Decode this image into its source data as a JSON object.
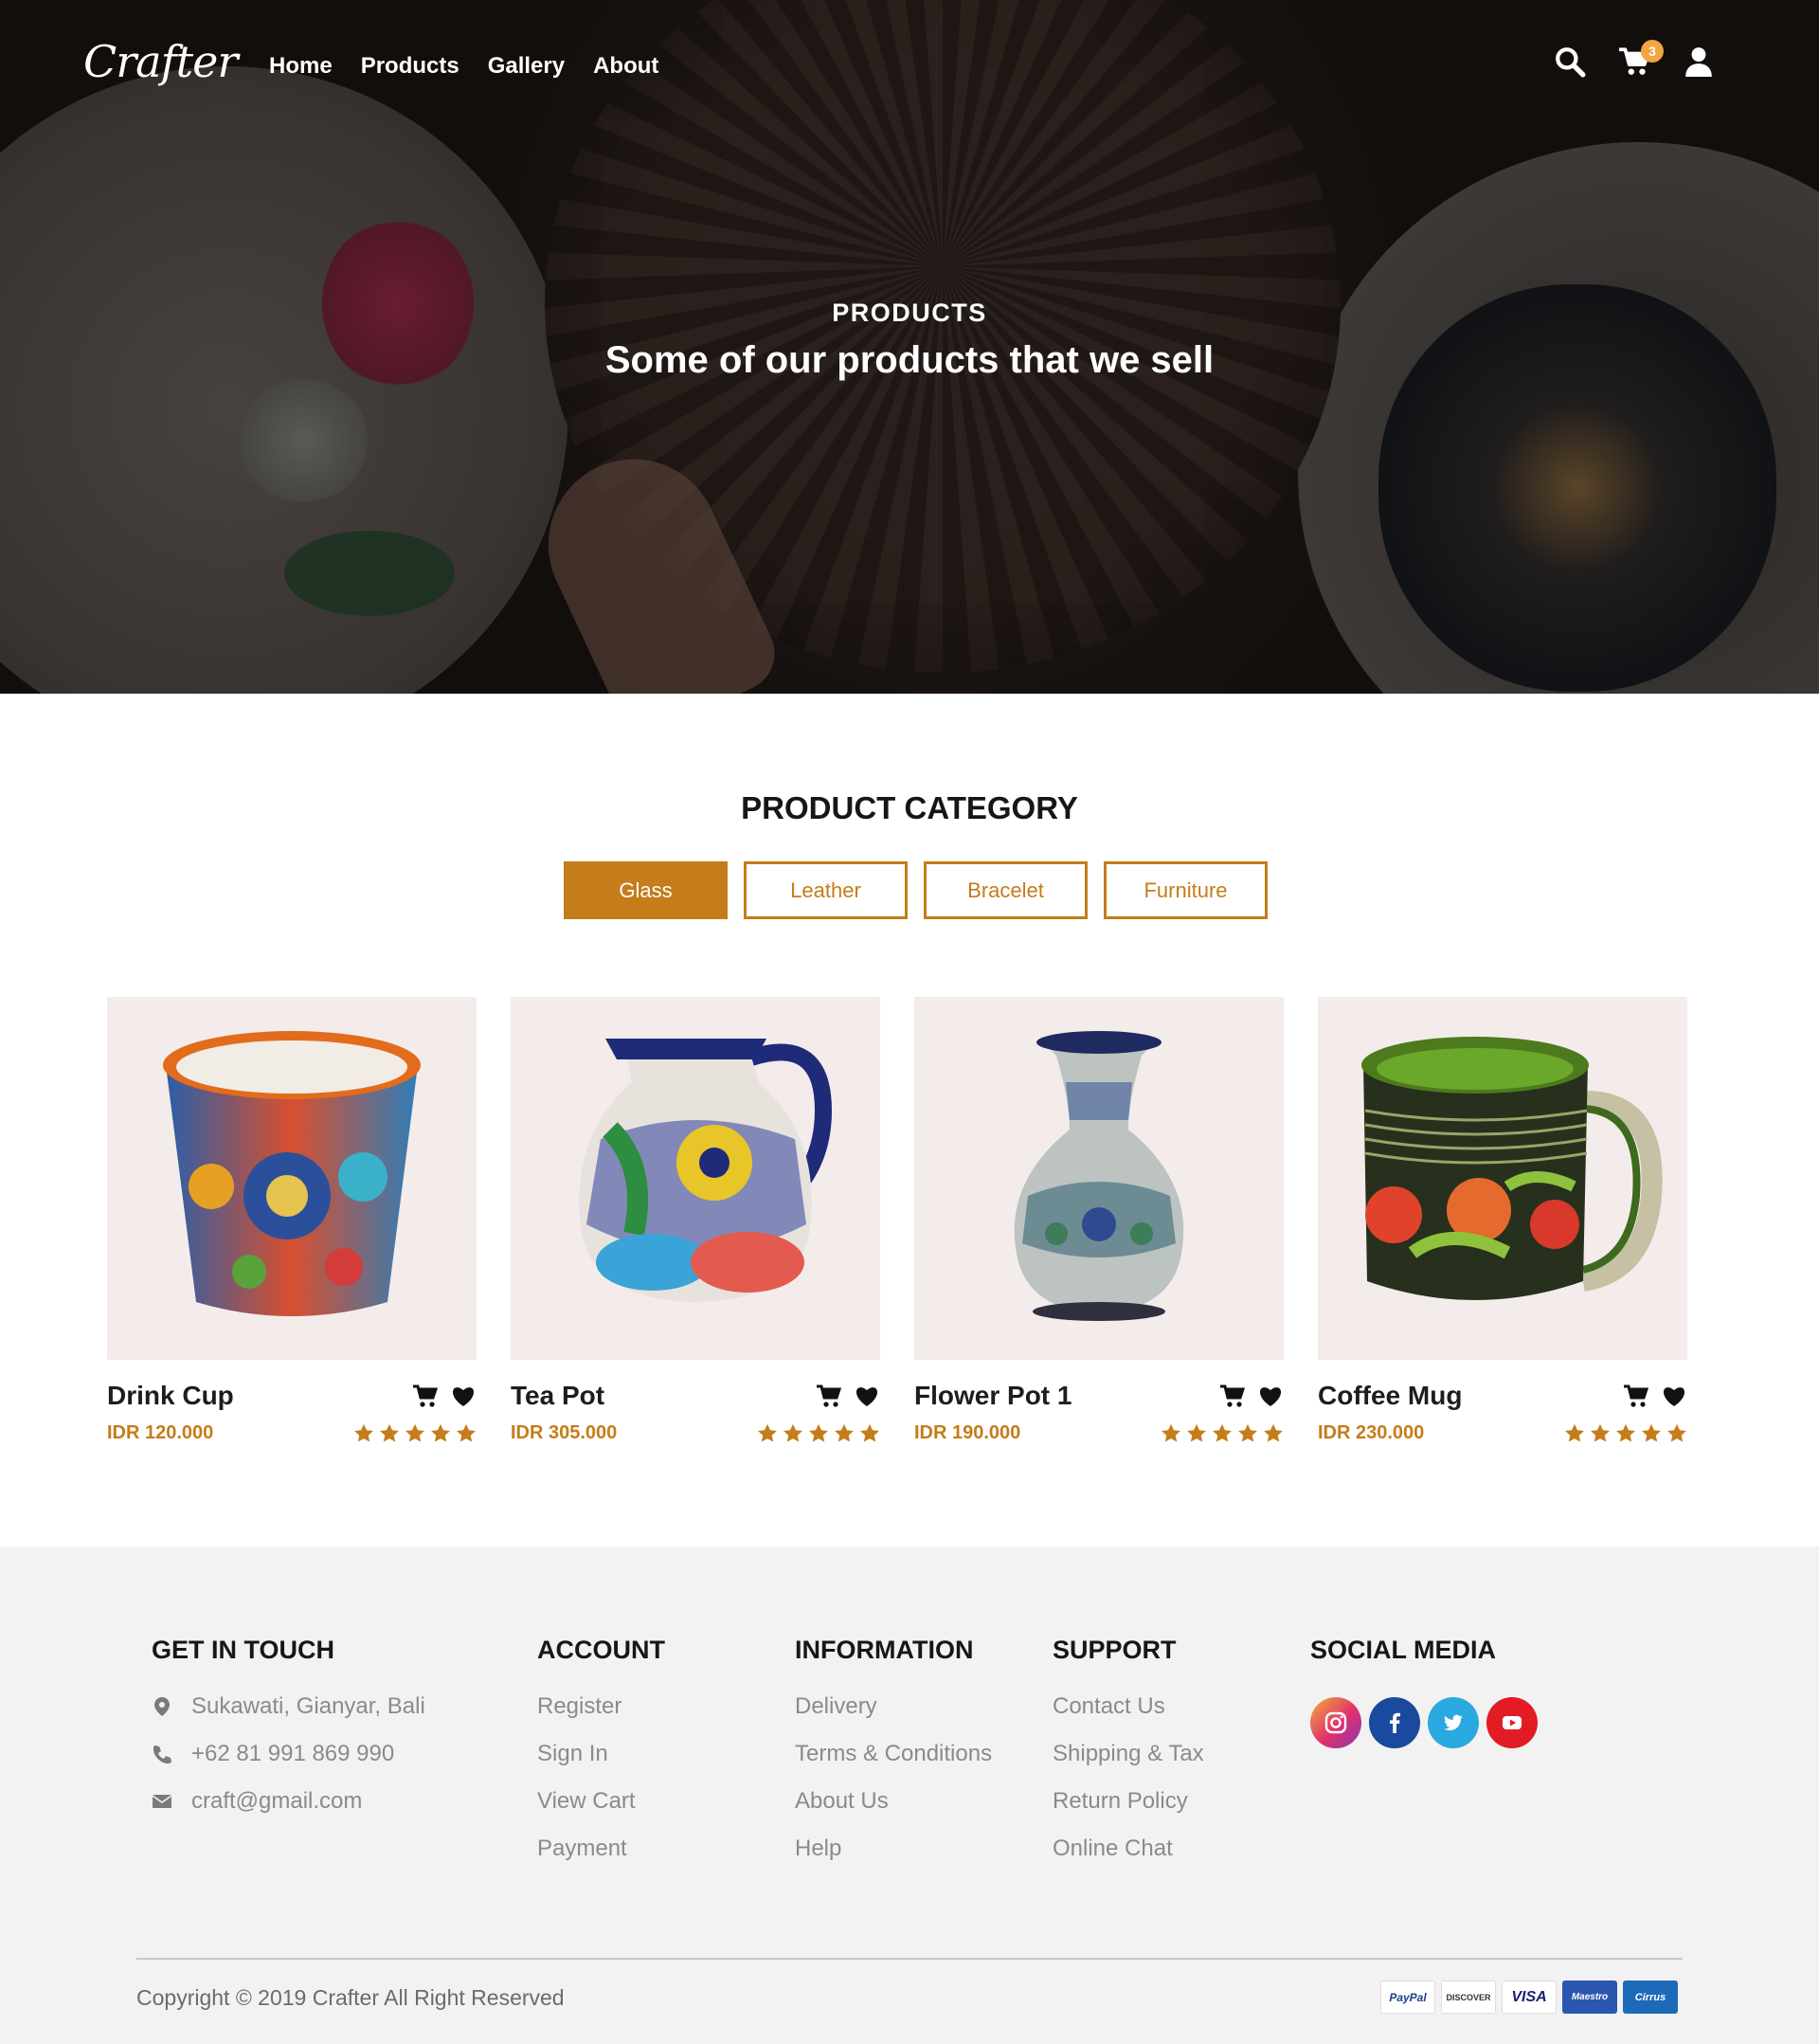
{
  "brand": {
    "logo": "Crafter",
    "accent": "#c57c1a",
    "badge_color": "#f2a540"
  },
  "nav": {
    "links": [
      "Home",
      "Products",
      "Gallery",
      "About"
    ],
    "cart_count": "3",
    "icons": [
      "search-icon",
      "cart-icon",
      "user-icon"
    ]
  },
  "hero": {
    "kicker": "PRODUCTS",
    "title": "Some of our products that we sell"
  },
  "category": {
    "title": "PRODUCT CATEGORY",
    "tabs": [
      "Glass",
      "Leather",
      "Bracelet",
      "Furniture"
    ],
    "active_tab": "Glass"
  },
  "products": [
    {
      "name": "Drink Cup",
      "price": "IDR 120.000",
      "rating": 5
    },
    {
      "name": "Tea Pot",
      "price": "IDR 305.000",
      "rating": 5
    },
    {
      "name": "Flower Pot 1",
      "price": "IDR 190.000",
      "rating": 5
    },
    {
      "name": "Coffee Mug",
      "price": "IDR 230.000",
      "rating": 5
    }
  ],
  "footer": {
    "contact": {
      "title": "GET IN TOUCH",
      "address": "Sukawati, Gianyar, Bali",
      "phone": "+62 81 991 869 990",
      "email": "craft@gmail.com"
    },
    "account": {
      "title": "ACCOUNT",
      "items": [
        "Register",
        "Sign In",
        "View Cart",
        "Payment"
      ]
    },
    "information": {
      "title": "INFORMATION",
      "items": [
        "Delivery",
        "Terms & Conditions",
        "About Us",
        "Help"
      ]
    },
    "support": {
      "title": "SUPPORT",
      "items": [
        "Contact Us",
        "Shipping & Tax",
        "Return Policy",
        "Online Chat"
      ]
    },
    "social": {
      "title": "SOCIAL MEDIA",
      "icons": [
        "instagram-icon",
        "facebook-icon",
        "twitter-icon",
        "youtube-icon"
      ]
    },
    "copyright": "Copyright © 2019 Crafter All Right Reserved",
    "payments": [
      "PayPal",
      "DISCOVER",
      "VISA",
      "Maestro",
      "Cirrus"
    ]
  }
}
